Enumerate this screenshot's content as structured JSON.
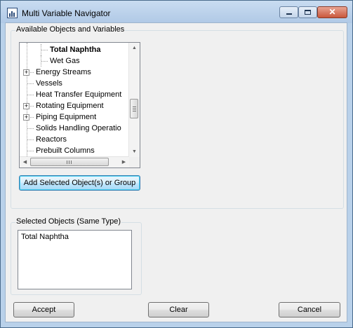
{
  "window": {
    "title": "Multi Variable Navigator",
    "controls": {
      "minimize": "minimize-icon",
      "maximize": "maximize-icon",
      "close": "close-icon"
    }
  },
  "available_group": {
    "title": "Available Objects and Variables",
    "tree_items": [
      {
        "label": "Total Naphtha",
        "level": 2,
        "bold": true,
        "expander": false
      },
      {
        "label": "Wet Gas",
        "level": 2,
        "bold": false,
        "expander": false
      },
      {
        "label": "Energy Streams",
        "level": 1,
        "bold": false,
        "expander": true
      },
      {
        "label": "Vessels",
        "level": 1,
        "bold": false,
        "expander": false
      },
      {
        "label": "Heat Transfer Equipment",
        "level": 1,
        "bold": false,
        "expander": false
      },
      {
        "label": "Rotating Equipment",
        "level": 1,
        "bold": false,
        "expander": true
      },
      {
        "label": "Piping Equipment",
        "level": 1,
        "bold": false,
        "expander": true
      },
      {
        "label": "Solids Handling Operatio",
        "level": 1,
        "bold": false,
        "expander": false
      },
      {
        "label": "Reactors",
        "level": 1,
        "bold": false,
        "expander": false
      },
      {
        "label": "Prebuilt Columns",
        "level": 1,
        "bold": false,
        "expander": false
      }
    ],
    "add_button_label": "Add Selected Object(s) or Group"
  },
  "selected_group": {
    "title": "Selected Objects (Same Type)",
    "items": [
      "Total Naphtha"
    ]
  },
  "footer": {
    "accept_label": "Accept",
    "clear_label": "Clear",
    "cancel_label": "Cancel"
  },
  "colors": {
    "title_bar": "#b9d1ea",
    "dialog_background": "#f0f0f0",
    "close_button": "#c9573b",
    "focus_border": "#3c7fb1"
  }
}
